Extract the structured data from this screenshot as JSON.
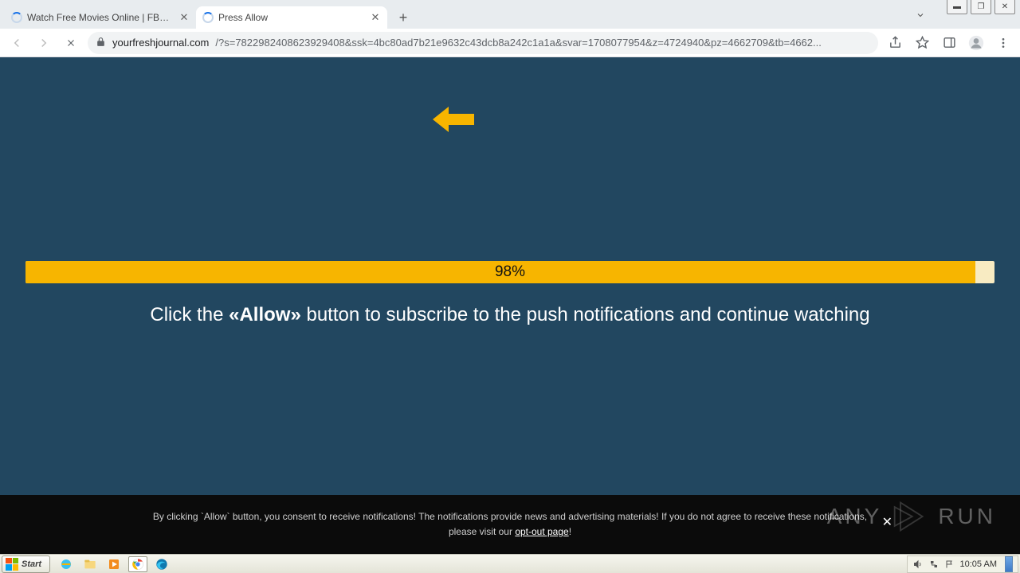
{
  "window": {
    "min": "▬",
    "max": "❐",
    "close": "✕"
  },
  "tabs": [
    {
      "title": "Watch Free Movies Online | FBOX | C"
    },
    {
      "title": "Press Allow"
    }
  ],
  "newtab": "+",
  "toolbar": {
    "url_host": "yourfreshjournal.com",
    "url_rest": "/?s=7822982408623929408&ssk=4bc80ad7b21e9632c43dcb8a242c1a1a&svar=1708077954&z=4724940&pz=4662709&tb=4662..."
  },
  "page": {
    "progress_pct": "98%",
    "instruction_pre": "Click the ",
    "instruction_bold": "«Allow»",
    "instruction_post": " button to subscribe to the push notifications and continue watching"
  },
  "consent": {
    "line1": "By clicking `Allow` button, you consent to receive notifications! The notifications provide news and advertising materials! If you do not agree to receive these notifications,",
    "line2_pre": "please visit our ",
    "line2_link": "opt-out page",
    "line2_post": "!"
  },
  "watermark": {
    "left": "ANY",
    "right": "RUN"
  },
  "taskbar": {
    "start": "Start",
    "clock": "10:05 AM"
  }
}
